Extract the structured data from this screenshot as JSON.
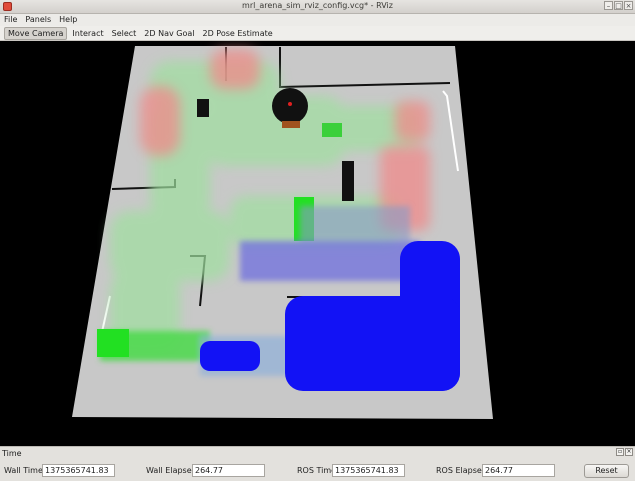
{
  "window": {
    "title": "mrl_arena_sim_rviz_config.vcg* - RViz",
    "btn_min": "–",
    "btn_max": "□",
    "btn_close": "×"
  },
  "menu": {
    "items": [
      "File",
      "Panels",
      "Help"
    ]
  },
  "toolbar": {
    "tools": [
      "Move Camera",
      "Interact",
      "Select",
      "2D Nav Goal",
      "2D Pose Estimate"
    ],
    "active": "Move Camera"
  },
  "time_panel": {
    "title": "Time",
    "wall_time_label": "Wall Time:",
    "wall_time_value": "1375365741.83",
    "wall_elapsed_label": "Wall Elapsed:",
    "wall_elapsed_value": "264.77",
    "ros_time_label": "ROS Time:",
    "ros_time_value": "1375365741.83",
    "ros_elapsed_label": "ROS Elapsed:",
    "ros_elapsed_value": "264.77",
    "reset_label": "Reset"
  },
  "colors": {
    "floor": "#c9c9c9",
    "path_green": "#22e022",
    "path_blue": "#1010ff",
    "path_red": "#ff8080",
    "background": "#000000"
  }
}
